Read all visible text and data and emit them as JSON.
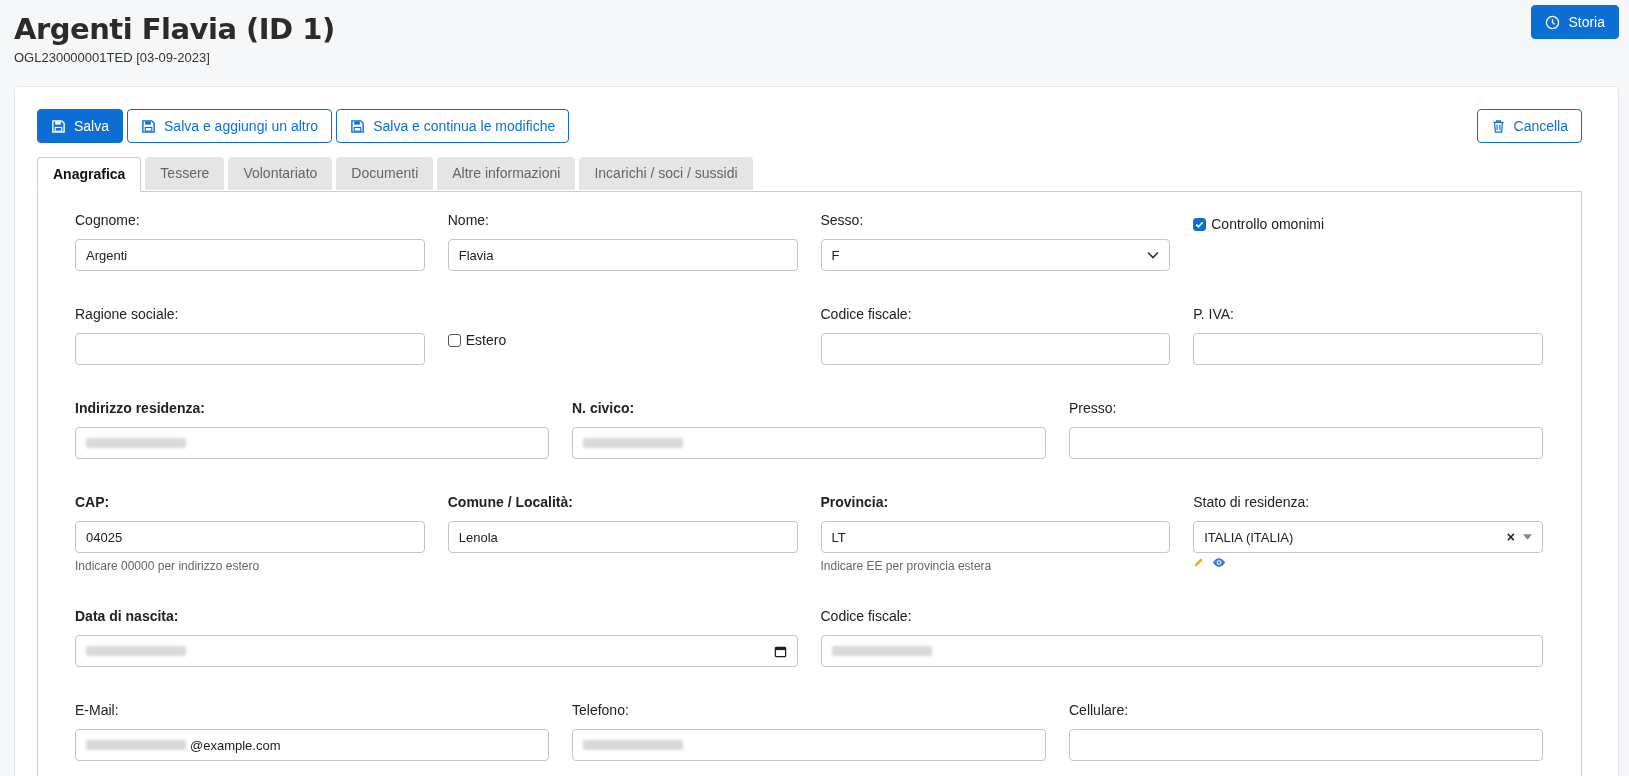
{
  "header": {
    "title": "Argenti Flavia (ID 1)",
    "subtitle": "OGL230000001TED [03-09-2023]",
    "history_button": "Storia"
  },
  "toolbar": {
    "buttons": [
      {
        "label": "Salva",
        "primary": true
      },
      {
        "label": "Salva e aggiungi un altro",
        "primary": false
      },
      {
        "label": "Salva e continua le modifiche",
        "primary": false
      }
    ],
    "delete_button": "Cancella"
  },
  "tabs": [
    {
      "label": "Anagrafica",
      "selected": true
    },
    {
      "label": "Tessere",
      "selected": false
    },
    {
      "label": "Volontariato",
      "selected": false
    },
    {
      "label": "Documenti",
      "selected": false
    },
    {
      "label": "Altre informazioni",
      "selected": false
    },
    {
      "label": "Incarichi / soci / sussidi",
      "selected": false
    }
  ],
  "form_rows": [
    {
      "fields": [
        {
          "kind": "text",
          "label": "Cognome:",
          "required": false,
          "value": "Argenti"
        },
        {
          "kind": "text",
          "label": "Nome:",
          "required": false,
          "value": "Flavia"
        },
        {
          "kind": "select",
          "label": "Sesso:",
          "required": false,
          "value": "F"
        },
        {
          "kind": "checkbox",
          "label": "Controllo omonimi",
          "checked": true
        }
      ]
    },
    {
      "fields": [
        {
          "kind": "text",
          "label": "Ragione sociale:",
          "required": false
        },
        {
          "kind": "checkbox",
          "label": "Estero",
          "checked": false
        },
        {
          "kind": "text",
          "label": "Codice fiscale:",
          "required": false
        },
        {
          "kind": "text",
          "label": "P. IVA:",
          "required": false
        }
      ]
    },
    {
      "fields": [
        {
          "kind": "text",
          "label": "Indirizzo residenza:",
          "required": true,
          "obscured": true
        },
        {
          "kind": "text",
          "label": "N. civico:",
          "required": true,
          "obscured": true
        },
        {
          "kind": "text",
          "label": "Presso:",
          "required": false
        }
      ]
    },
    {
      "fields": [
        {
          "kind": "text",
          "label": "CAP:",
          "required": true,
          "value": "04025",
          "help": "Indicare 00000 per indirizzo estero"
        },
        {
          "kind": "text",
          "label": "Comune / Località:",
          "required": true,
          "value": "Lenola"
        },
        {
          "kind": "text",
          "label": "Provincia:",
          "required": true,
          "value": "LT",
          "help": "Indicare EE per provincia estera"
        },
        {
          "kind": "combobox",
          "label": "Stato di residenza:",
          "required": false,
          "value": "ITALIA (ITALIA)",
          "clear": "×"
        }
      ]
    },
    {
      "fields": [
        {
          "kind": "date",
          "label": "Data di nascita:",
          "required": true,
          "obscured": true
        },
        {
          "kind": "text",
          "label": "Codice fiscale:",
          "required": false,
          "obscured": true
        }
      ]
    },
    {
      "fields": [
        {
          "kind": "text",
          "label": "E-Mail:",
          "required": false,
          "obscured": true,
          "value": "@example.com"
        },
        {
          "kind": "text",
          "label": "Telefono:",
          "required": false,
          "obscured": true
        },
        {
          "kind": "text",
          "label": "Cellulare:",
          "required": false
        }
      ]
    }
  ]
}
